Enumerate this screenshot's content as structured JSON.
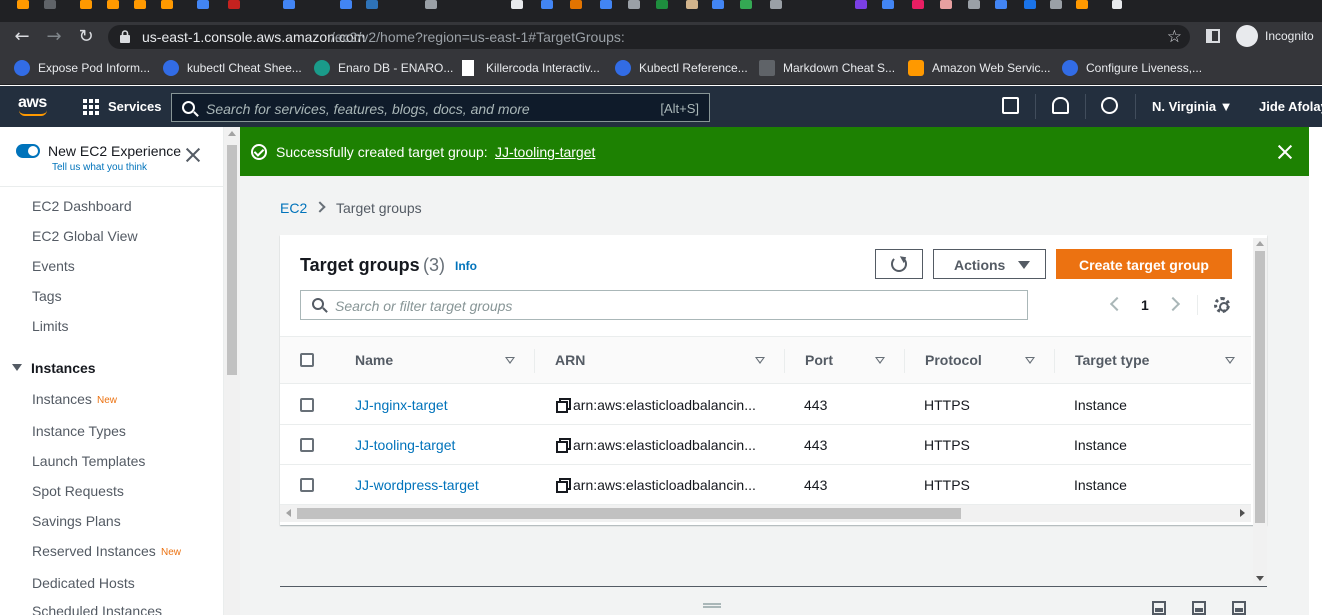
{
  "browser": {
    "url_host": "us-east-1.console.aws.amazon.com",
    "url_path": "/ec2/v2/home?region=us-east-1#TargetGroups:",
    "profile_label": "Incognito",
    "bookmarks": [
      {
        "label": "Expose Pod Inform...",
        "color": "#326ce5"
      },
      {
        "label": "kubectl Cheat Shee...",
        "color": "#326ce5"
      },
      {
        "label": "Enaro DB - ENARO...",
        "color": "#1a9b8a"
      },
      {
        "label": "Killercoda Interactiv...",
        "color": "#ffffff"
      },
      {
        "label": "Kubectl Reference...",
        "color": "#326ce5"
      },
      {
        "label": "Markdown Cheat S...",
        "color": "#5f6368"
      },
      {
        "label": "Amazon Web Servic...",
        "color": "#ff9900"
      },
      {
        "label": "Configure Liveness,...",
        "color": "#326ce5"
      }
    ]
  },
  "awsnav": {
    "logo": "aws",
    "services_label": "Services",
    "search_placeholder": "Search for services, features, blogs, docs, and more",
    "search_shortcut": "[Alt+S]",
    "region": "N. Virginia ▼",
    "account": "Jide Afolaya"
  },
  "sidebar": {
    "new_experience_label": "New EC2 Experience",
    "feedback_link": "Tell us what you think",
    "top_items": [
      "EC2 Dashboard",
      "EC2 Global View",
      "Events",
      "Tags",
      "Limits"
    ],
    "section_label": "Instances",
    "section_items": [
      "Instances",
      "Instance Types",
      "Launch Templates",
      "Spot Requests",
      "Savings Plans",
      "Reserved Instances",
      "Dedicated Hosts",
      "Scheduled Instances"
    ],
    "new_badge": "New"
  },
  "flash": {
    "message": "Successfully created target group:",
    "link": "JJ-tooling-target"
  },
  "breadcrumb": {
    "root": "EC2",
    "current": "Target groups"
  },
  "panel": {
    "title": "Target groups",
    "count": "(3)",
    "info": "Info",
    "actions_label": "Actions",
    "create_label": "Create target group",
    "filter_placeholder": "Search or filter target groups",
    "page": "1"
  },
  "table": {
    "columns": [
      "Name",
      "ARN",
      "Port",
      "Protocol",
      "Target type"
    ],
    "rows": [
      {
        "name": "JJ-nginx-target",
        "arn": "arn:aws:elasticloadbalancin...",
        "port": "443",
        "protocol": "HTTPS",
        "type": "Instance"
      },
      {
        "name": "JJ-tooling-target",
        "arn": "arn:aws:elasticloadbalancin...",
        "port": "443",
        "protocol": "HTTPS",
        "type": "Instance"
      },
      {
        "name": "JJ-wordpress-target",
        "arn": "arn:aws:elasticloadbalancin...",
        "port": "443",
        "protocol": "HTTPS",
        "type": "Instance"
      }
    ]
  },
  "colors": {
    "accent": "#0073bb",
    "primary_button": "#ec7211",
    "success": "#1d8102",
    "aws_nav": "#232f3e"
  }
}
